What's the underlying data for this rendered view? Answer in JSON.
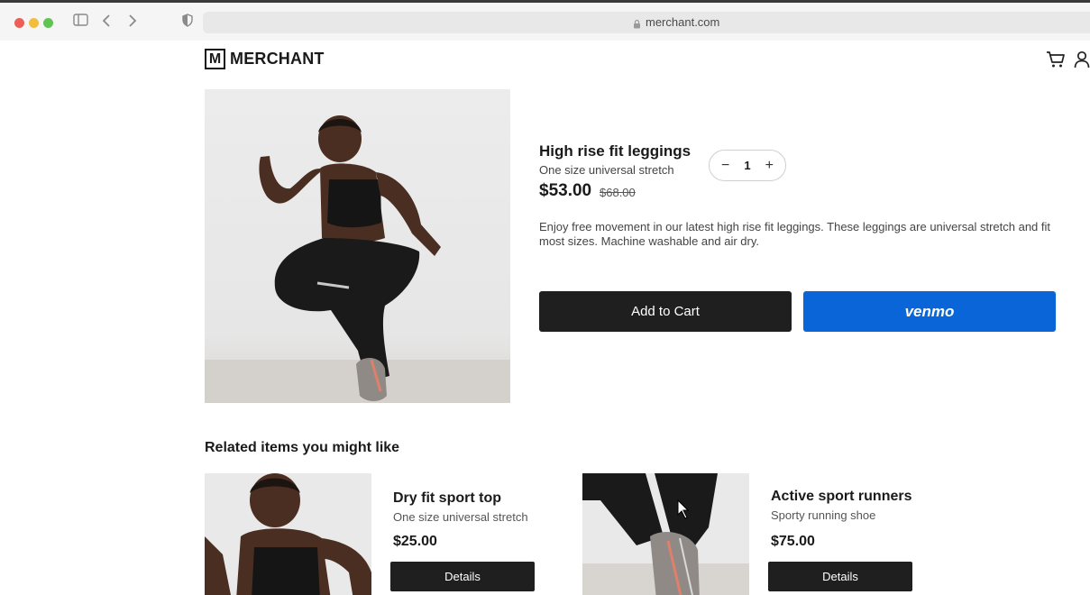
{
  "browser": {
    "url": "merchant.com",
    "sidebar_icon": "sidebar-icon",
    "back_icon": "chevron-left-icon",
    "forward_icon": "chevron-right-icon",
    "shield_icon": "shield-icon",
    "lock_icon": "lock-icon"
  },
  "header": {
    "logo_mark": "M",
    "logo_text": "MERCHANT",
    "cart_icon": "cart-icon",
    "account_icon": "user-icon"
  },
  "product": {
    "title": "High rise fit leggings",
    "subtitle": "One size universal stretch",
    "price": "$53.00",
    "old_price": "$68.00",
    "quantity": "1",
    "minus": "−",
    "plus": "+",
    "description": "Enjoy free movement in our latest high rise fit leggings. These leggings are universal stretch and fit most sizes. Machine washable and air dry.",
    "add_to_cart": "Add to Cart",
    "venmo": "venmo"
  },
  "related": {
    "heading": "Related items you might like",
    "items": [
      {
        "title": "Dry fit sport top",
        "subtitle": "One size universal stretch",
        "price": "$25.00",
        "button": "Details"
      },
      {
        "title": "Active sport runners",
        "subtitle": "Sporty running shoe",
        "price": "$75.00",
        "button": "Details"
      }
    ]
  },
  "colors": {
    "venmo_blue": "#0a66d8",
    "button_dark": "#1f1f1f"
  }
}
